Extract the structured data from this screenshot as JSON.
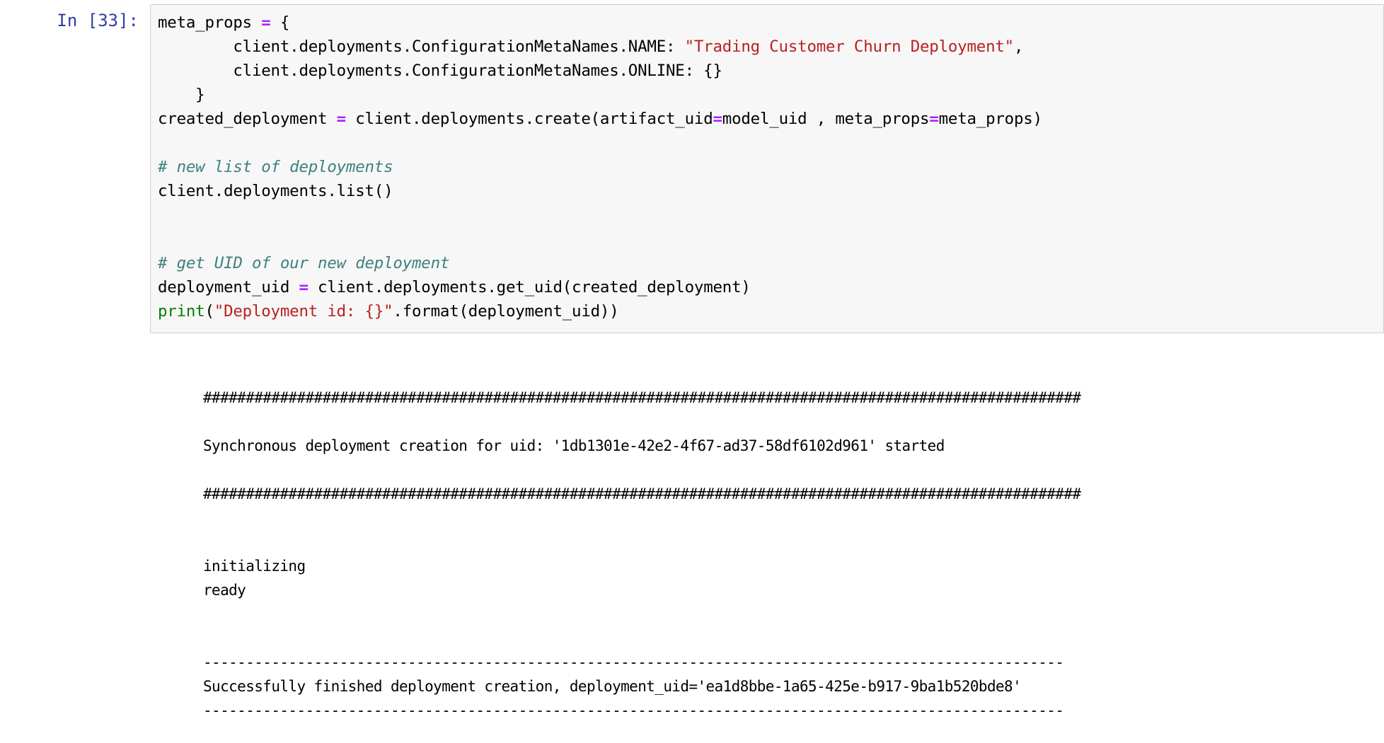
{
  "notebook": {
    "cell": {
      "prompt_label": "In [33]:",
      "execution_count": 33,
      "cell_type": "code",
      "language": "python",
      "source_lines": [
        "meta_props = {",
        "        client.deployments.ConfigurationMetaNames.NAME: \"Trading Customer Churn Deployment\",",
        "        client.deployments.ConfigurationMetaNames.ONLINE: {}",
        "    }",
        "created_deployment = client.deployments.create(artifact_uid=model_uid , meta_props=meta_props)",
        "",
        "# new list of deployments",
        "client.deployments.list()",
        "",
        "",
        "# get UID of our new deployment",
        "deployment_uid = client.deployments.get_uid(created_deployment)",
        "print(\"Deployment id: {}\".format(deployment_uid))"
      ],
      "tokens": {
        "assign_operator": "=",
        "string_name_value": "\"Trading Customer Churn Deployment\"",
        "string_print_value": "\"Deployment id: {}\"",
        "comment_1": "# new list of deployments",
        "comment_2": "# get UID of our new deployment",
        "builtin_print": "print"
      }
    },
    "output": {
      "output_type": "stream",
      "lines": {
        "hash_rule_top": "#######################################################################################################",
        "started_message": "Synchronous deployment creation for uid: '1db1301e-42e2-4f67-ad37-58df6102d961' started",
        "hash_rule_bottom": "#######################################################################################################",
        "status_initializing": "initializing",
        "status_ready": "ready",
        "dash_rule_top": "-----------------------------------------------------------------------------------------------------",
        "finished_message": "Successfully finished deployment creation, deployment_uid='ea1d8bbe-1a65-425e-b917-9ba1b520bde8'",
        "dash_rule_bottom": "-----------------------------------------------------------------------------------------------------"
      },
      "values": {
        "creation_uid": "1db1301e-42e2-4f67-ad37-58df6102d961",
        "deployment_uid": "ea1d8bbe-1a65-425e-b917-9ba1b520bde8",
        "statuses": [
          "initializing",
          "ready"
        ]
      }
    },
    "colors": {
      "prompt": "#303F9F",
      "cell_background": "#f7f7f7",
      "cell_border": "#cfcfcf",
      "operator": "#AA22FF",
      "string": "#BA2121",
      "comment": "#408080",
      "builtin": "#008000",
      "text": "#000000"
    }
  }
}
